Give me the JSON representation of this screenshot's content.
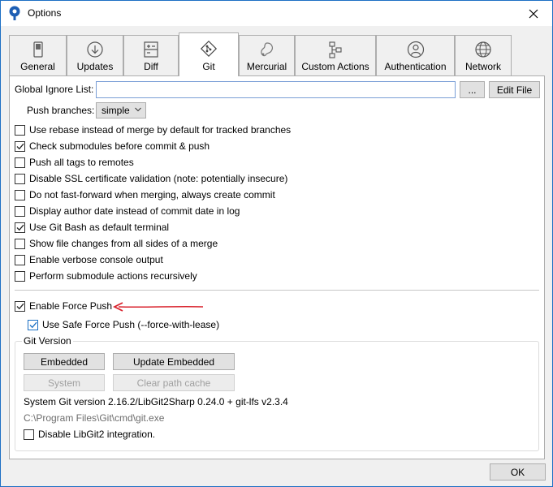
{
  "window": {
    "title": "Options"
  },
  "tabs": [
    {
      "label": "General",
      "icon": "switch-icon"
    },
    {
      "label": "Updates",
      "icon": "download-icon"
    },
    {
      "label": "Diff",
      "icon": "diff-icon"
    },
    {
      "label": "Git",
      "icon": "git-icon",
      "active": true
    },
    {
      "label": "Mercurial",
      "icon": "mercurial-icon"
    },
    {
      "label": "Custom Actions",
      "icon": "flow-icon"
    },
    {
      "label": "Authentication",
      "icon": "user-icon"
    },
    {
      "label": "Network",
      "icon": "globe-icon"
    }
  ],
  "git": {
    "global_ignore_label": "Global Ignore List:",
    "global_ignore_value": "",
    "browse_label": "...",
    "edit_file_label": "Edit File",
    "push_branches_label": "Push branches:",
    "push_branches_value": "simple",
    "options": [
      {
        "label": "Use rebase instead of merge by default for tracked branches",
        "checked": false
      },
      {
        "label": "Check submodules before commit & push",
        "checked": true
      },
      {
        "label": "Push all tags to remotes",
        "checked": false
      },
      {
        "label": "Disable SSL certificate validation (note: potentially insecure)",
        "checked": false
      },
      {
        "label": "Do not fast-forward when merging, always create commit",
        "checked": false
      },
      {
        "label": "Display author date instead of commit date in log",
        "checked": false
      },
      {
        "label": "Use Git Bash as default terminal",
        "checked": true
      },
      {
        "label": "Show file changes from all sides of a merge",
        "checked": false
      },
      {
        "label": "Enable verbose console output",
        "checked": false
      },
      {
        "label": "Perform submodule actions recursively",
        "checked": false
      }
    ],
    "force_push": {
      "label": "Enable Force Push",
      "checked": true
    },
    "safe_force_push": {
      "label": "Use Safe Force Push (--force-with-lease)",
      "checked": true
    },
    "git_version": {
      "group_title": "Git Version",
      "embedded_label": "Embedded",
      "update_embedded_label": "Update Embedded",
      "system_label": "System",
      "clear_cache_label": "Clear path cache",
      "version_text": "System Git version 2.16.2/LibGit2Sharp 0.24.0 + git-lfs v2.3.4",
      "path_text": "C:\\Program Files\\Git\\cmd\\git.exe",
      "disable_libgit2": {
        "label": "Disable LibGit2 integration.",
        "checked": false
      }
    }
  },
  "footer": {
    "ok_label": "OK"
  },
  "colors": {
    "accent": "#1a6fc4",
    "arrow": "#d9232d"
  }
}
